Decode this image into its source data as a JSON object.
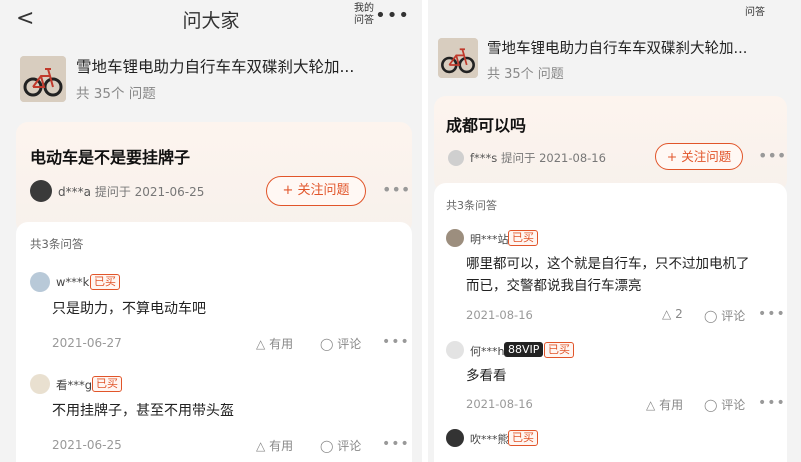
{
  "left": {
    "header": {
      "back": "<",
      "title": "问大家",
      "ask": "我的问答",
      "more": "•••"
    },
    "product": {
      "name": "雪地车锂电助力自行车车双碟刹大轮加...",
      "count": "共 35个 问题"
    },
    "question": {
      "title": "电动车是不是要挂牌子",
      "asker": "d***a",
      "asked": "提问于 2021-06-25",
      "follow": "+ 关注问题",
      "more": "•••"
    },
    "answers_count": "共3条问答",
    "answers": [
      {
        "user": "w***k",
        "badge": "已买",
        "text": "只是助力，不算电动车吧",
        "date": "2021-06-27",
        "useful": "有用",
        "comment": "评论",
        "more": "•••"
      },
      {
        "user": "看***g",
        "badge": "已买",
        "text": "不用挂牌子，甚至不用带头盔",
        "date": "2021-06-25",
        "useful": "有用",
        "comment": "评论",
        "more": "•••"
      }
    ]
  },
  "right": {
    "product": {
      "name": "雪地车锂电助力自行车车双碟刹大轮加...",
      "count": "共 35个 问题"
    },
    "header_partial": "问答",
    "question": {
      "title": "成都可以吗",
      "asker": "f***s",
      "asked": "提问于 2021-08-16",
      "follow": "+ 关注问题",
      "more": "•••"
    },
    "answers_count": "共3条问答",
    "answers": [
      {
        "user": "明***站",
        "badge": "已买",
        "vip": "",
        "text_line1": "哪里都可以，这个就是自行车，只不过加电机了",
        "text_line2": "而已，交警都说我自行车漂亮",
        "date": "2021-08-16",
        "useful": "2",
        "comment": "评论",
        "more": "•••"
      },
      {
        "user": "何***h",
        "badge": "已买",
        "vip": "88VIP",
        "text_line1": "多看看",
        "text_line2": "",
        "date": "2021-08-16",
        "useful": "有用",
        "comment": "评论",
        "more": "•••"
      },
      {
        "user": "吹***熊",
        "badge": "已买",
        "vip": ""
      }
    ]
  }
}
